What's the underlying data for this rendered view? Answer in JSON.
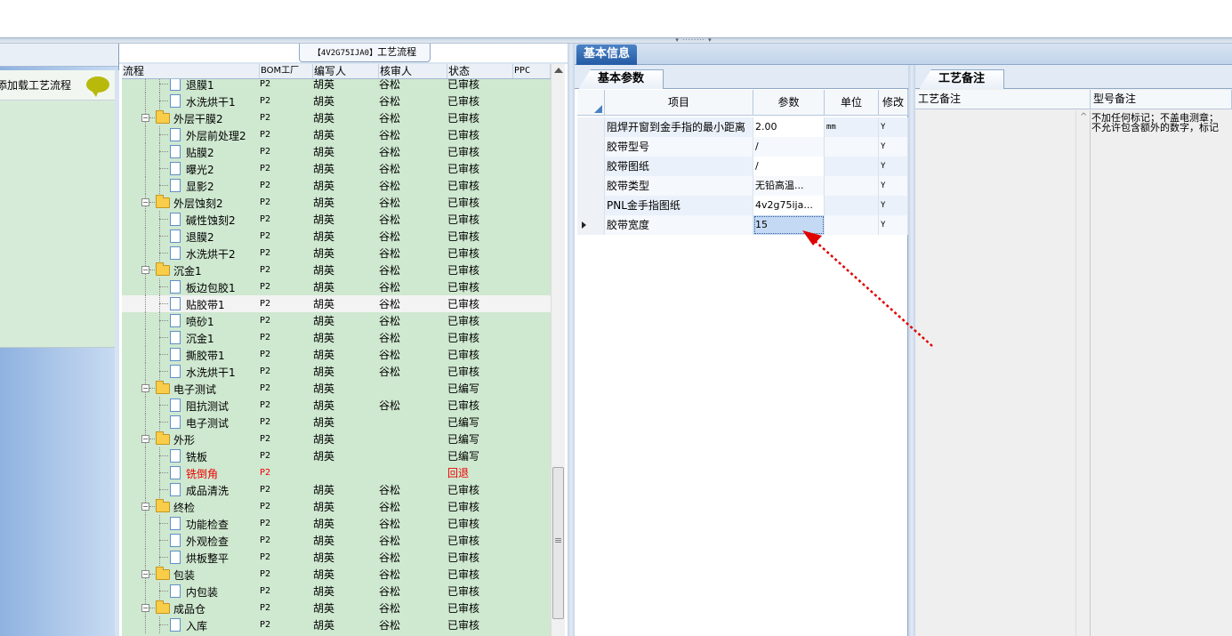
{
  "left_panel": {
    "load_label": "添加载工艺流程"
  },
  "process": {
    "title_code": "【4V2G75IJA0】",
    "title_suffix": "工艺流程",
    "columns": [
      "流程",
      "BOM工厂",
      "编写人",
      "核审人",
      "状态",
      "PPC"
    ],
    "rows": [
      {
        "name": "退膜1",
        "type": "doc",
        "factory": "P2",
        "writer": "胡英",
        "reviewer": "谷松",
        "status": "已审核"
      },
      {
        "name": "水洗烘干1",
        "type": "doc",
        "factory": "P2",
        "writer": "胡英",
        "reviewer": "谷松",
        "status": "已审核"
      },
      {
        "name": "外层干膜2",
        "type": "folder",
        "factory": "P2",
        "writer": "胡英",
        "reviewer": "谷松",
        "status": "已审核"
      },
      {
        "name": "外层前处理2",
        "type": "doc",
        "factory": "P2",
        "writer": "胡英",
        "reviewer": "谷松",
        "status": "已审核"
      },
      {
        "name": "贴膜2",
        "type": "doc",
        "factory": "P2",
        "writer": "胡英",
        "reviewer": "谷松",
        "status": "已审核"
      },
      {
        "name": "曝光2",
        "type": "doc",
        "factory": "P2",
        "writer": "胡英",
        "reviewer": "谷松",
        "status": "已审核"
      },
      {
        "name": "显影2",
        "type": "doc",
        "factory": "P2",
        "writer": "胡英",
        "reviewer": "谷松",
        "status": "已审核"
      },
      {
        "name": "外层蚀刻2",
        "type": "folder",
        "factory": "P2",
        "writer": "胡英",
        "reviewer": "谷松",
        "status": "已审核"
      },
      {
        "name": "碱性蚀刻2",
        "type": "doc",
        "factory": "P2",
        "writer": "胡英",
        "reviewer": "谷松",
        "status": "已审核"
      },
      {
        "name": "退膜2",
        "type": "doc",
        "factory": "P2",
        "writer": "胡英",
        "reviewer": "谷松",
        "status": "已审核"
      },
      {
        "name": "水洗烘干2",
        "type": "doc",
        "factory": "P2",
        "writer": "胡英",
        "reviewer": "谷松",
        "status": "已审核"
      },
      {
        "name": "沉金1",
        "type": "folder",
        "factory": "P2",
        "writer": "胡英",
        "reviewer": "谷松",
        "status": "已审核"
      },
      {
        "name": "板边包胶1",
        "type": "doc",
        "factory": "P2",
        "writer": "胡英",
        "reviewer": "谷松",
        "status": "已审核"
      },
      {
        "name": "贴胶带1",
        "type": "doc",
        "factory": "P2",
        "writer": "胡英",
        "reviewer": "谷松",
        "status": "已审核",
        "selected": true
      },
      {
        "name": "喷砂1",
        "type": "doc",
        "factory": "P2",
        "writer": "胡英",
        "reviewer": "谷松",
        "status": "已审核"
      },
      {
        "name": "沉金1",
        "type": "doc",
        "factory": "P2",
        "writer": "胡英",
        "reviewer": "谷松",
        "status": "已审核"
      },
      {
        "name": "撕胶带1",
        "type": "doc",
        "factory": "P2",
        "writer": "胡英",
        "reviewer": "谷松",
        "status": "已审核"
      },
      {
        "name": "水洗烘干1",
        "type": "doc",
        "factory": "P2",
        "writer": "胡英",
        "reviewer": "谷松",
        "status": "已审核"
      },
      {
        "name": "电子测试",
        "type": "folder",
        "factory": "P2",
        "writer": "胡英",
        "reviewer": "",
        "status": "已编写"
      },
      {
        "name": "阻抗测试",
        "type": "doc",
        "factory": "P2",
        "writer": "胡英",
        "reviewer": "谷松",
        "status": "已审核"
      },
      {
        "name": "电子测试",
        "type": "doc",
        "factory": "P2",
        "writer": "胡英",
        "reviewer": "",
        "status": "已编写"
      },
      {
        "name": "外形",
        "type": "folder",
        "factory": "P2",
        "writer": "胡英",
        "reviewer": "",
        "status": "已编写"
      },
      {
        "name": "铣板",
        "type": "doc",
        "factory": "P2",
        "writer": "胡英",
        "reviewer": "",
        "status": "已编写"
      },
      {
        "name": "铣倒角",
        "type": "doc",
        "factory": "P2",
        "writer": "",
        "reviewer": "",
        "status": "回退",
        "red": true
      },
      {
        "name": "成品清洗",
        "type": "doc",
        "factory": "P2",
        "writer": "胡英",
        "reviewer": "谷松",
        "status": "已审核"
      },
      {
        "name": "终检",
        "type": "folder",
        "factory": "P2",
        "writer": "胡英",
        "reviewer": "谷松",
        "status": "已审核"
      },
      {
        "name": "功能检查",
        "type": "doc",
        "factory": "P2",
        "writer": "胡英",
        "reviewer": "谷松",
        "status": "已审核"
      },
      {
        "name": "外观检查",
        "type": "doc",
        "factory": "P2",
        "writer": "胡英",
        "reviewer": "谷松",
        "status": "已审核"
      },
      {
        "name": "烘板整平",
        "type": "doc",
        "factory": "P2",
        "writer": "胡英",
        "reviewer": "谷松",
        "status": "已审核"
      },
      {
        "name": "包装",
        "type": "folder",
        "factory": "P2",
        "writer": "胡英",
        "reviewer": "谷松",
        "status": "已审核"
      },
      {
        "name": "内包装",
        "type": "doc",
        "factory": "P2",
        "writer": "胡英",
        "reviewer": "谷松",
        "status": "已审核"
      },
      {
        "name": "成品仓",
        "type": "folder",
        "factory": "P2",
        "writer": "胡英",
        "reviewer": "谷松",
        "status": "已审核"
      },
      {
        "name": "入库",
        "type": "doc",
        "factory": "P2",
        "writer": "胡英",
        "reviewer": "谷松",
        "status": "已审核"
      }
    ]
  },
  "info": {
    "tab_label": "基本信息",
    "params_tab": "基本参数",
    "param_columns": [
      "项目",
      "参数",
      "单位",
      "修改"
    ],
    "params": [
      {
        "item": "阻焊开窗到金手指的最小距离",
        "value": "2.00",
        "unit": "mm",
        "mod": "Y"
      },
      {
        "item": "胶带型号",
        "value": "/",
        "unit": "",
        "mod": "Y"
      },
      {
        "item": "胶带图纸",
        "value": "/",
        "unit": "",
        "mod": "Y"
      },
      {
        "item": "胶带类型",
        "value": "无铅高温...",
        "unit": "",
        "mod": "Y"
      },
      {
        "item": "PNL金手指图纸",
        "value": "4v2g75ija...",
        "unit": "",
        "mod": "Y"
      },
      {
        "item": "胶带宽度",
        "value": "15",
        "unit": "",
        "mod": "Y",
        "current": true
      }
    ],
    "remarks_tab": "工艺备注",
    "remark_columns": [
      "工艺备注",
      "型号备注"
    ],
    "model_remark_lines": [
      "不加任何标记；不盖电测章；",
      "不允许包含额外的数字，标记"
    ]
  },
  "colors": {
    "tree_bg": "#cfe8d0",
    "tab_blue": "#235ba4",
    "arrow_red": "#e00000"
  }
}
